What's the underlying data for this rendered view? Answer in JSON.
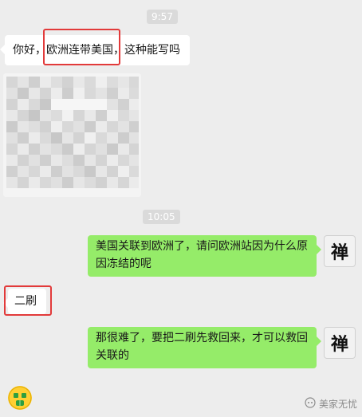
{
  "timestamps": [
    "9:57",
    "10:05"
  ],
  "messages": [
    {
      "side": "left",
      "text": "你好，欧洲连带美国，这种能写吗"
    },
    {
      "side": "right",
      "text": "美国关联到欧洲了，请问欧洲站因为什么原因冻结的呢",
      "avatar": "禅"
    },
    {
      "side": "left",
      "text": "二刷"
    },
    {
      "side": "right",
      "text": "那很难了，要把二刷先救回来，才可以救回关联的",
      "avatar": "禅"
    }
  ],
  "image_message": {
    "type": "pixelated-image"
  },
  "emoji": {
    "icon": "money-mouth-face-icon"
  },
  "watermark": {
    "text": "美家无忧",
    "icon": "wechat-channel-icon"
  },
  "colors": {
    "background": "#ededed",
    "left_bubble": "#ffffff",
    "right_bubble": "#95ec69",
    "highlight_box": "#e23a3a"
  }
}
